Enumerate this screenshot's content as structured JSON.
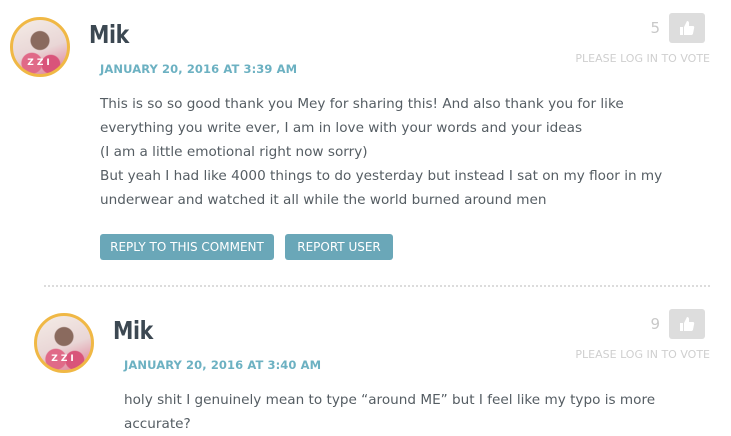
{
  "comments": [
    {
      "author": "Mik",
      "timestamp": "JANUARY 20, 2016 AT 3:39 AM",
      "vote_count": "5",
      "login_note": "PLEASE LOG IN TO VOTE",
      "body_lines": [
        "This is so so good thank you Mey for sharing this! And also thank you for like everything you write ever, I am in love with your words and your ideas",
        "(I am a little emotional right now sorry)",
        "But yeah I had like 4000 things to do yesterday but instead I sat on my floor in my underwear and watched it all while the world burned around men"
      ],
      "reply_label": "REPLY TO THIS COMMENT",
      "report_label": "REPORT USER"
    },
    {
      "author": "Mik",
      "timestamp": "JANUARY 20, 2016 AT 3:40 AM",
      "vote_count": "9",
      "login_note": "PLEASE LOG IN TO VOTE",
      "body_lines": [
        "holy shit I genuinely mean to type “around ME” but I feel like my typo is more accurate?"
      ]
    }
  ],
  "colors": {
    "accent": "#6aa7b8",
    "timestamp": "#6cb1c2",
    "avatar_ring": "#f0b845"
  },
  "icons": {
    "vote": "thumbs-up-icon"
  }
}
